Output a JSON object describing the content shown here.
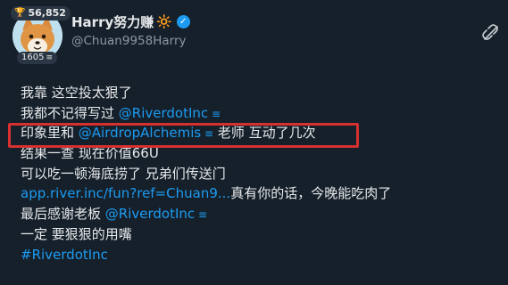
{
  "profile": {
    "display_name": "Harry努力赚",
    "name_emoji": "🔆",
    "handle": "@Chuan9958Harry",
    "top_badge_value": "56,852",
    "bottom_badge_value": "1605",
    "verified": true
  },
  "post": {
    "lines": [
      {
        "text": "我靠   这空投太狠了"
      },
      {
        "prefix": "我都不记得写过 ",
        "mention": "@RiverdotInc"
      },
      {
        "prefix": "印象里和 ",
        "mention": "@AirdropAlchemis",
        "suffix": " 老师 互动了几次"
      },
      {
        "text": "结果一查 现在价值66U"
      },
      {
        "text": "可以吃一顿海底捞了 兄弟们传送门"
      },
      {
        "link": "app.river.inc/fun?ref=Chuan9...",
        "suffix": "真有你的话，今晚能吃肉了"
      },
      {
        "prefix": "最后感谢老板 ",
        "mention": "@RiverdotInc"
      },
      {
        "text": "一定 要狠狠的用嘴"
      },
      {
        "hashtag": "#RiverdotInc"
      }
    ]
  },
  "colors": {
    "background": "#15202b",
    "accent": "#1d9bf0",
    "highlight_border": "#d6302f",
    "text": "#e7e9ea",
    "muted": "#8b98a5"
  },
  "icons": {
    "badge_top": "trophy-icon",
    "badge_bottom": "stack-icon",
    "verified": "verified-check-icon",
    "top_right": "link-off-icon"
  }
}
